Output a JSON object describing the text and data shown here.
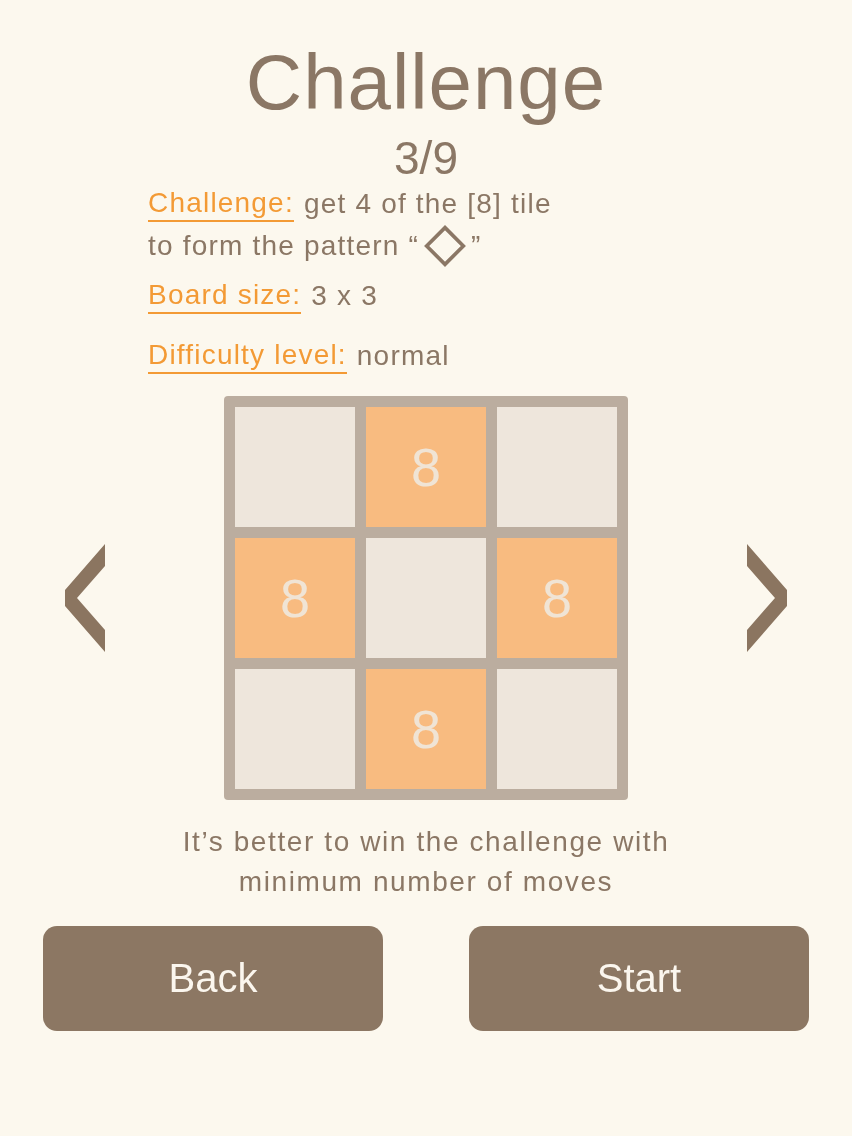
{
  "title": "Challenge",
  "challenge_number": "3/9",
  "info": [
    {
      "kind": "pattern",
      "label": "Challenge:",
      "value": "get 4 of the [8] tile",
      "pattern_text": "to form the pattern “",
      "suffix": "”"
    },
    {
      "kind": "plain",
      "label": "Board size:",
      "value": "3 x 3"
    },
    {
      "kind": "plain",
      "label": "Difficulty level:",
      "value": "normal"
    }
  ],
  "board": {
    "cells": [
      {
        "kind": "empty"
      },
      {
        "kind": "tile",
        "value": "8"
      },
      {
        "kind": "empty"
      },
      {
        "kind": "tile",
        "value": "8"
      },
      {
        "kind": "empty"
      },
      {
        "kind": "tile",
        "value": "8"
      },
      {
        "kind": "empty"
      },
      {
        "kind": "tile",
        "value": "8"
      },
      {
        "kind": "empty"
      }
    ]
  },
  "hint": "It’s better to win the challenge with minimum number of moves",
  "buttons": [
    {
      "label": "Back"
    },
    {
      "label": "Start"
    }
  ]
}
